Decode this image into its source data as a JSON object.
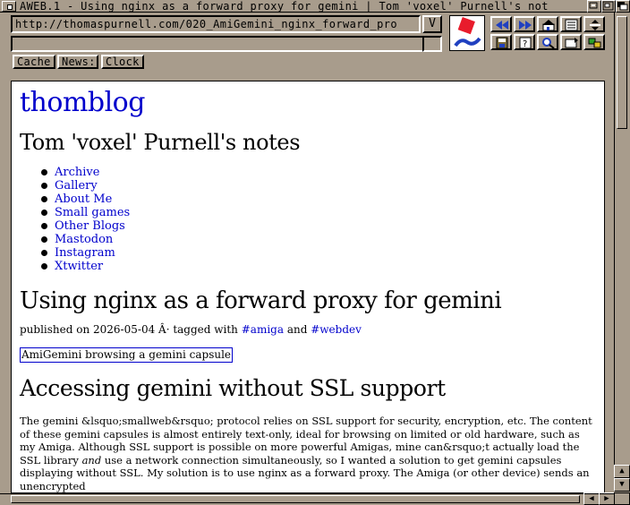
{
  "window": {
    "title": "AWEB.1 - Using nginx as a forward proxy for gemini | Tom 'voxel' Purnell's not"
  },
  "toolbar": {
    "url": "http://thomaspurnell.com/020_AmiGemini_nginx_forward_pro",
    "url_dropdown": "V",
    "buttons": [
      "Cache",
      "News:",
      "Clock"
    ]
  },
  "icons": {
    "row1": [
      "rewind-icon",
      "fast-forward-icon",
      "home-icon",
      "hotlist-icon",
      "scroll-icon"
    ],
    "row2": [
      "save-icon",
      "help-icon",
      "search-icon",
      "reload-icon",
      "load-images-icon"
    ]
  },
  "page": {
    "site_title": "thomblog",
    "subtitle": "Tom 'voxel' Purnell's notes",
    "nav": [
      "Archive",
      "Gallery",
      "About Me",
      "Small games",
      "Other Blogs",
      "Mastodon",
      "Instagram",
      "Xtwitter"
    ],
    "post_title": "Using nginx as a forward proxy for gemini",
    "meta_prefix": "published on 2026-05-04 Â· tagged with ",
    "tag1": "#amiga",
    "meta_and": " and ",
    "tag2": "#webdev",
    "image_alt": "AmiGemini browsing a gemini capsule",
    "section_heading": "Accessing gemini without SSL support",
    "para_part1": "The gemini &lsquo;smallweb&rsquo; protocol relies on SSL support for security, encryption, etc. The content of these gemini capsules is almost entirely text-only, ideal for browsing on limited or old hardware, such as my Amiga. Although SSL support is possible on more powerful Amigas, mine can&rsquo;t actually load the SSL library ",
    "para_em": "and",
    "para_part2": " use a network connection simultaneously, so I wanted a solution to get gemini capsules displaying without SSL. My solution is to use nginx as a forward proxy. The Amiga (or other device) sends an unencrypted"
  },
  "colors": {
    "chrome": "#a89c8c",
    "link": "#0000cc",
    "logo_red": "#e81c2c",
    "logo_blue": "#2040c0"
  }
}
